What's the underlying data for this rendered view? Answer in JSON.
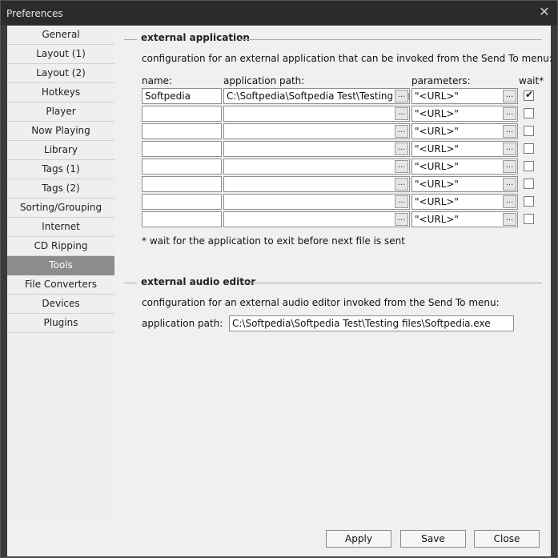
{
  "window": {
    "title": "Preferences"
  },
  "sidebar": {
    "items": [
      {
        "label": "General"
      },
      {
        "label": "Layout (1)"
      },
      {
        "label": "Layout (2)"
      },
      {
        "label": "Hotkeys"
      },
      {
        "label": "Player"
      },
      {
        "label": "Now Playing"
      },
      {
        "label": "Library"
      },
      {
        "label": "Tags (1)"
      },
      {
        "label": "Tags (2)"
      },
      {
        "label": "Sorting/Grouping"
      },
      {
        "label": "Internet"
      },
      {
        "label": "CD Ripping"
      },
      {
        "label": "Tools"
      },
      {
        "label": "File Converters"
      },
      {
        "label": "Devices"
      },
      {
        "label": "Plugins"
      }
    ],
    "selected": "Tools"
  },
  "external_application": {
    "title": "external application",
    "description": "configuration for an external application that can be invoked from the Send To menu:",
    "columns": {
      "name": "name:",
      "path": "application path:",
      "params": "parameters:",
      "wait": "wait*"
    },
    "browse_label": "...",
    "rows": [
      {
        "name": "Softpedia",
        "path": "C:\\Softpedia\\Softpedia Test\\Testing file",
        "params": "\"<URL>\"",
        "wait": true
      },
      {
        "name": "",
        "path": "",
        "params": "\"<URL>\"",
        "wait": false
      },
      {
        "name": "",
        "path": "",
        "params": "\"<URL>\"",
        "wait": false
      },
      {
        "name": "",
        "path": "",
        "params": "\"<URL>\"",
        "wait": false
      },
      {
        "name": "",
        "path": "",
        "params": "\"<URL>\"",
        "wait": false
      },
      {
        "name": "",
        "path": "",
        "params": "\"<URL>\"",
        "wait": false
      },
      {
        "name": "",
        "path": "",
        "params": "\"<URL>\"",
        "wait": false
      },
      {
        "name": "",
        "path": "",
        "params": "\"<URL>\"",
        "wait": false
      }
    ],
    "footnote": "* wait for the application to exit before next file is sent"
  },
  "external_audio_editor": {
    "title": "external audio editor",
    "description": "configuration for an external audio editor invoked from the Send To menu:",
    "path_label": "application path:",
    "path_value": "C:\\Softpedia\\Softpedia Test\\Testing files\\Softpedia.exe"
  },
  "footer": {
    "apply": "Apply",
    "save": "Save",
    "close": "Close"
  }
}
